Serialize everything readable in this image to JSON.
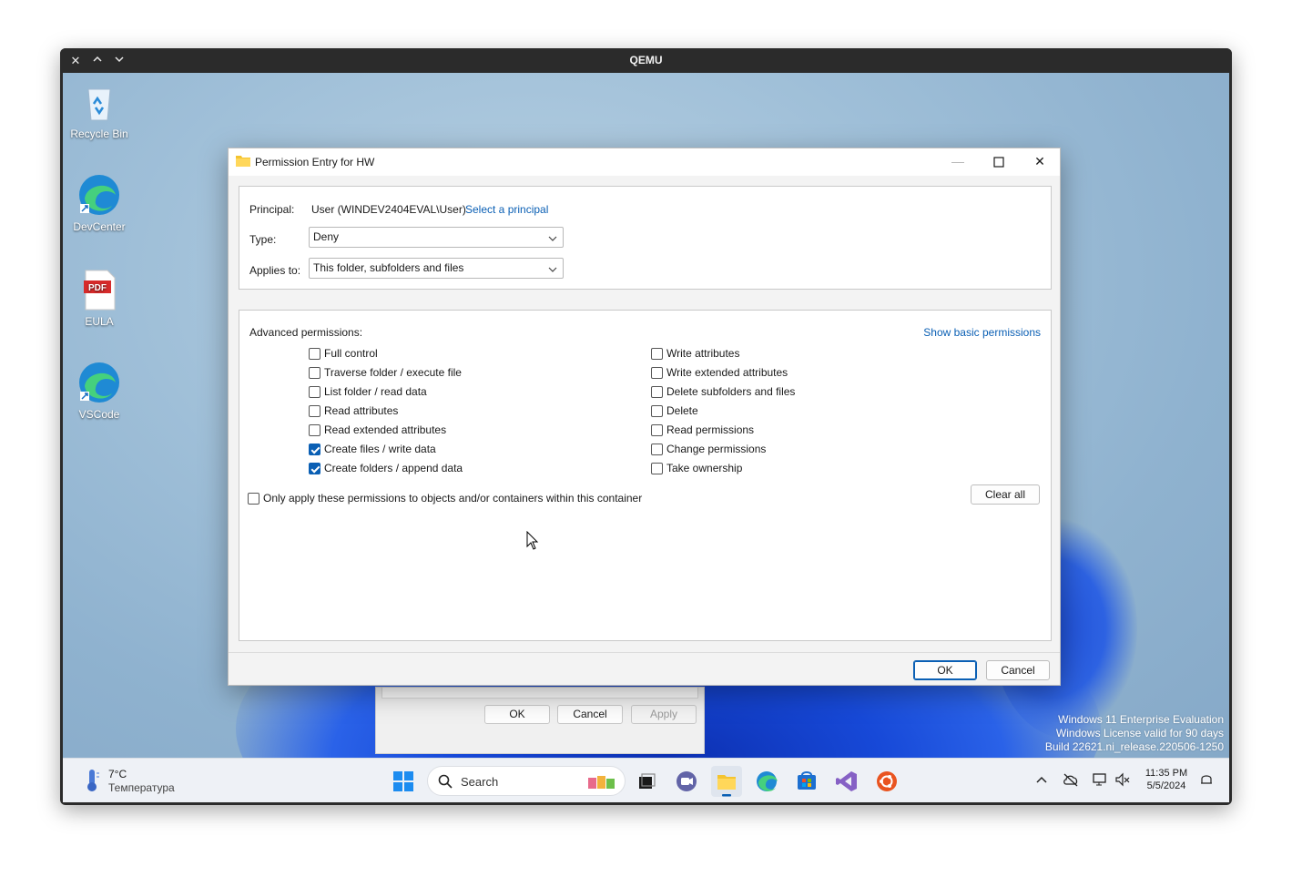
{
  "qemu": {
    "title": "QEMU"
  },
  "desktop": {
    "icons": [
      {
        "label": "Recycle Bin"
      },
      {
        "label": "DevCenter"
      },
      {
        "label": "EULA"
      },
      {
        "label": "VSCode"
      }
    ],
    "watermark": {
      "line1": "Windows 11 Enterprise Evaluation",
      "line2": "Windows License valid for 90 days",
      "line3": "Build 22621.ni_release.220506-1250"
    },
    "background_dialog": {
      "ok": "OK",
      "cancel": "Cancel",
      "apply": "Apply"
    }
  },
  "taskbar": {
    "weather": {
      "temp": "7°C",
      "condition": "Температура"
    },
    "search": {
      "label": "Search"
    },
    "apps": [
      "start-icon",
      "task-view-icon",
      "teams-icon",
      "file-explorer-icon",
      "edge-icon",
      "store-icon",
      "visual-studio-icon",
      "ubuntu-icon"
    ],
    "clock": {
      "time": "11:35 PM",
      "date": "5/5/2024"
    }
  },
  "dialog": {
    "title": "Permission Entry for HW",
    "principal_label": "Principal:",
    "principal_value": "User (WINDEV2404EVAL\\User)",
    "select_principal": "Select a principal",
    "type_label": "Type:",
    "type_value": "Deny",
    "applies_label": "Applies to:",
    "applies_value": "This folder, subfolders and files",
    "advanced_label": "Advanced permissions:",
    "show_basic": "Show basic permissions",
    "left_permissions": [
      {
        "label": "Full control",
        "checked": false
      },
      {
        "label": "Traverse folder / execute file",
        "checked": false
      },
      {
        "label": "List folder / read data",
        "checked": false
      },
      {
        "label": "Read attributes",
        "checked": false
      },
      {
        "label": "Read extended attributes",
        "checked": false
      },
      {
        "label": "Create files / write data",
        "checked": true
      },
      {
        "label": "Create folders / append data",
        "checked": true
      }
    ],
    "right_permissions": [
      {
        "label": "Write attributes",
        "checked": false
      },
      {
        "label": "Write extended attributes",
        "checked": false
      },
      {
        "label": "Delete subfolders and files",
        "checked": false
      },
      {
        "label": "Delete",
        "checked": false
      },
      {
        "label": "Read permissions",
        "checked": false
      },
      {
        "label": "Change permissions",
        "checked": false
      },
      {
        "label": "Take ownership",
        "checked": false
      }
    ],
    "only_apply": {
      "label": "Only apply these permissions to objects and/or containers within this container",
      "checked": false
    },
    "clear_all": "Clear all",
    "ok": "OK",
    "cancel": "Cancel"
  }
}
